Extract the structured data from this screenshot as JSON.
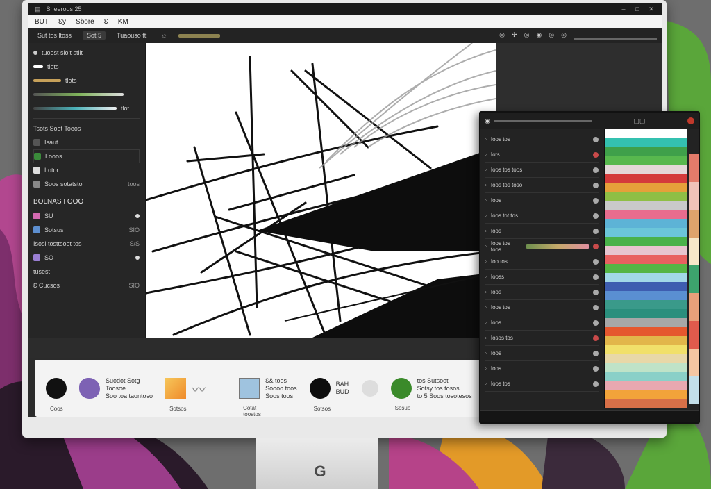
{
  "window": {
    "title": "Sneeroos 25",
    "controls": [
      "–",
      "□",
      "✕"
    ]
  },
  "menubar": {
    "items": [
      "BUT",
      "Ɛy",
      "Sbore",
      "Ɛ",
      "KM"
    ]
  },
  "toolbar": {
    "items": [
      "Sut tos ltoss",
      "Sot 5",
      "Tuaouso tt",
      "☼"
    ],
    "right_icons": [
      "◎",
      "✣",
      "◎",
      "◉",
      "◎",
      "◎"
    ]
  },
  "left_panel": {
    "top_label": "tuoest sioit stiit",
    "rows": [
      {
        "label": "tlots"
      },
      {
        "label": "tlots"
      },
      {
        "label": "tlot"
      },
      {
        "label": "Tsots Soet Toeos"
      },
      {
        "label": "Isaut"
      }
    ],
    "layer_items": [
      {
        "label": "Looos",
        "value": ""
      },
      {
        "label": "Lotor",
        "value": ""
      },
      {
        "label": "Soos sotatsto",
        "value": "toos"
      }
    ],
    "section_title": "BOLNAS I OOO",
    "section_items": [
      {
        "label": "SU",
        "value": ""
      },
      {
        "label": "Sotsus",
        "value": "SIO"
      },
      {
        "label": "Isosl tosttsoet tos",
        "value": "S/S"
      },
      {
        "label": "SO",
        "value": ""
      },
      {
        "label": "tusest",
        "value": ""
      },
      {
        "label": "Ɛ Cucsos",
        "value": "SIO"
      }
    ]
  },
  "brushes": [
    {
      "name": "black-brush",
      "color": "#111111",
      "label": "",
      "caption": "Coos"
    },
    {
      "name": "purple-brush",
      "color": "#7d62b4",
      "label": "Suodot Sotg\nToosoe\nSoo toa taontoso",
      "caption": ""
    },
    {
      "name": "orange-brush",
      "color": "#f0a93a",
      "label": "",
      "caption": "Sotsos"
    },
    {
      "name": "blue-brush",
      "color": "#9fc3df",
      "label": "Ɛ& toos\nSoooo toos\nSoos toos",
      "caption": "Cotat\ntoostos"
    },
    {
      "name": "black-blob-brush",
      "color": "#0d0d0d",
      "label": "BAH\nBUD",
      "caption": "Sotsos"
    },
    {
      "name": "gray-brush",
      "color": "#dddddd",
      "label": "",
      "caption": ""
    },
    {
      "name": "green-brush",
      "color": "#3a8a2a",
      "label": "tos Sutsoot\nSotsy tos tosos\nto 5 Soos tosotesos",
      "caption": "Sosuo"
    }
  ],
  "layers_panel": {
    "rows": [
      "Ioos tos",
      "Iots",
      "Ioos tos toos",
      "Ioos tos toso",
      "Ioos",
      "Ioos tot tos",
      "Ioos",
      "Ioos tos toos",
      "Ioo tos",
      "Iooss",
      "Ioos",
      "Ioos tos",
      "Ioos",
      "Iosos tos",
      "Ioos",
      "Ioos",
      "Ioos tos"
    ]
  },
  "colors": {
    "stripes": [
      "#ffffff",
      "#34c1b0",
      "#3fa04a",
      "#58b84e",
      "#e4d8d8",
      "#d43b3b",
      "#e6a13a",
      "#8fbf45",
      "#c9c9c9",
      "#e86c8e",
      "#5db3d6",
      "#6bc6d9",
      "#49b24a",
      "#e7c4cf",
      "#e86060",
      "#55b545",
      "#a2d8e8",
      "#3e5db0",
      "#5a8fd2",
      "#3a9a8a",
      "#2a8f7d",
      "#a7a7a7",
      "#e5572e",
      "#e2b64a",
      "#f1e06a",
      "#e8d8a8",
      "#bfe3c8",
      "#8ad0c8",
      "#e9a8b0",
      "#f2a33a",
      "#d87048"
    ],
    "side_stripes": [
      "#e37b6a",
      "#f0c2b8",
      "#dfa36c",
      "#f7e7c9",
      "#3da36d",
      "#e8a07a",
      "#e05a4c",
      "#f4c6a2",
      "#c3dfe9"
    ]
  }
}
